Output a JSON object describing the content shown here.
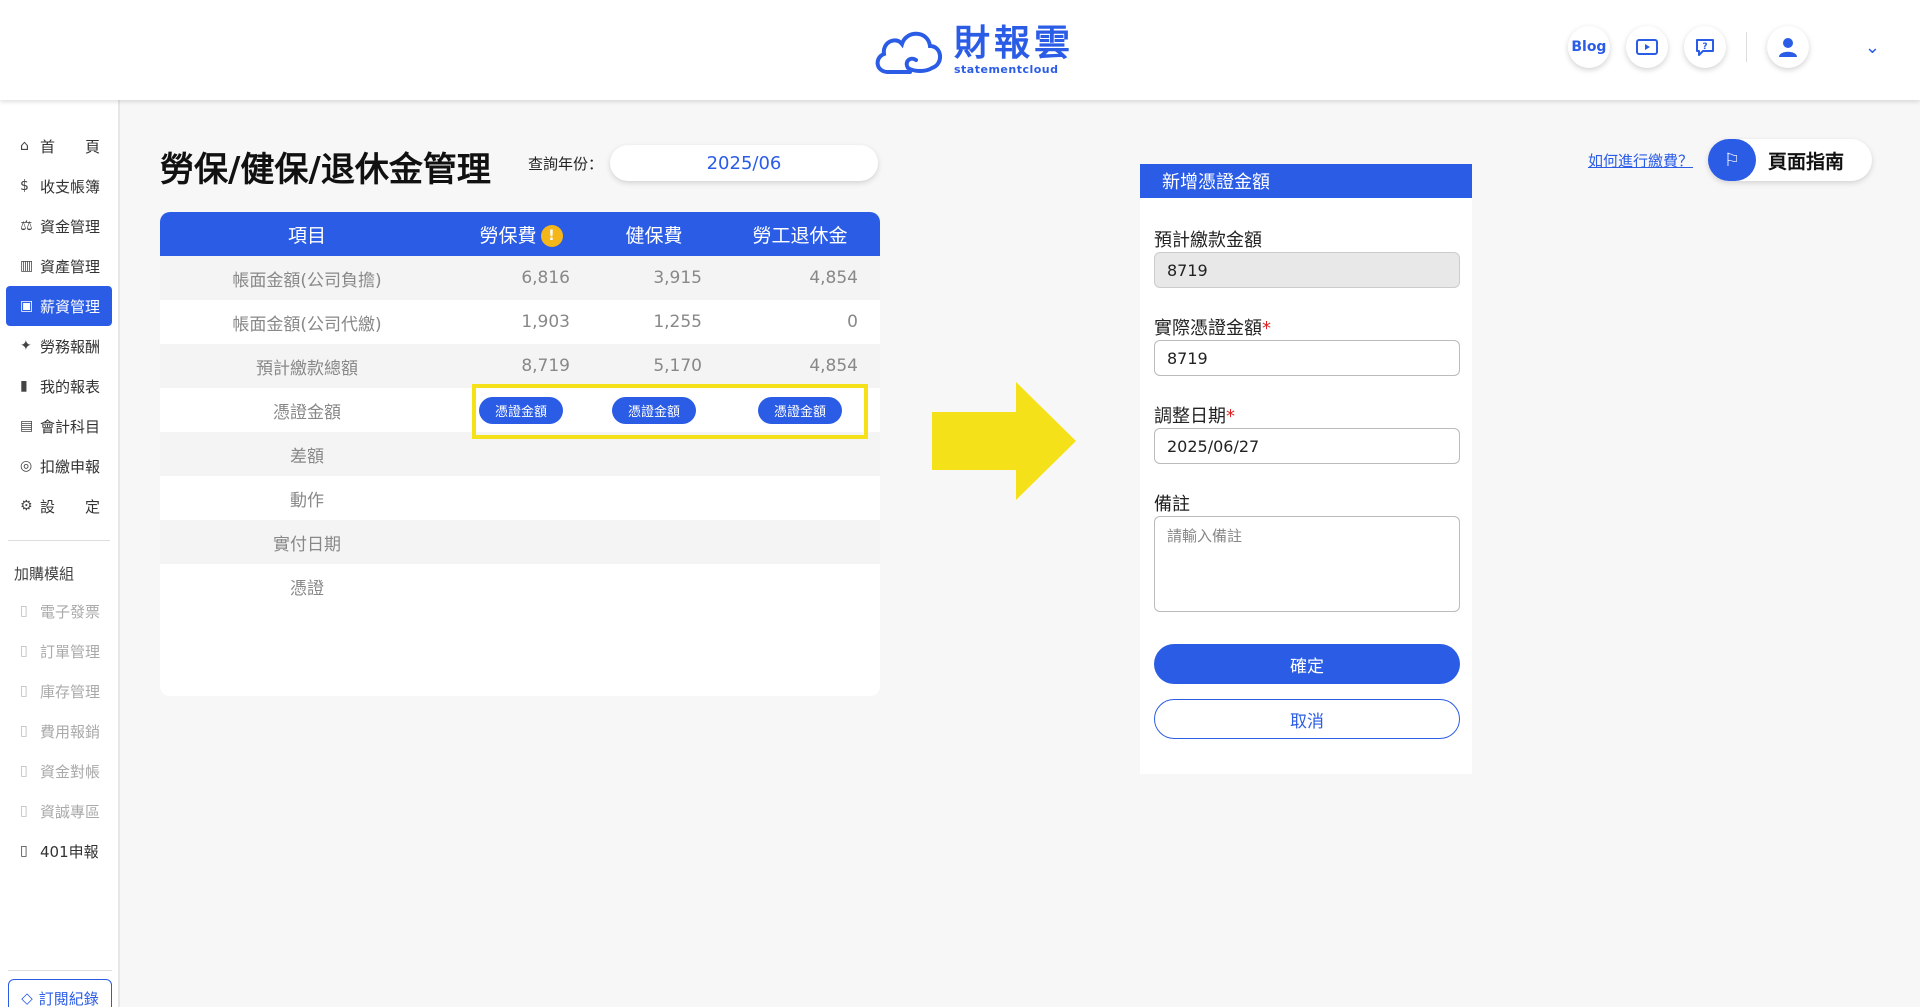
{
  "header": {
    "logo_cn": "財報雲",
    "logo_en": "statementcloud",
    "blog_label": "Blog"
  },
  "sidebar": {
    "items": [
      {
        "icon": "home-icon",
        "glyph": "⌂",
        "label": "首　　頁"
      },
      {
        "icon": "ledger-icon",
        "glyph": "$",
        "label": "收支帳簿"
      },
      {
        "icon": "funds-icon",
        "glyph": "⚖",
        "label": "資金管理"
      },
      {
        "icon": "assets-icon",
        "glyph": "▥",
        "label": "資產管理"
      },
      {
        "icon": "payroll-icon",
        "glyph": "▣",
        "label": "薪資管理"
      },
      {
        "icon": "labor-icon",
        "glyph": "✦",
        "label": "勞務報酬"
      },
      {
        "icon": "report-icon",
        "glyph": "▮",
        "label": "我的報表"
      },
      {
        "icon": "accounts-icon",
        "glyph": "▤",
        "label": "會計科目"
      },
      {
        "icon": "tax-icon",
        "glyph": "◎",
        "label": "扣繳申報"
      },
      {
        "icon": "settings-icon",
        "glyph": "⚙",
        "label": "設　　定"
      }
    ],
    "addon_header": "加購模組",
    "addons": [
      {
        "label": "電子發票"
      },
      {
        "label": "訂單管理"
      },
      {
        "label": "庫存管理"
      },
      {
        "label": "費用報銷"
      },
      {
        "label": "資金對帳"
      },
      {
        "label": "資誠專區"
      },
      {
        "label": "401申報"
      }
    ],
    "subscription_label": "訂閱紀錄"
  },
  "main": {
    "title": "勞保/健保/退休金管理",
    "year_label": "查詢年份：",
    "year_value": "2025/06",
    "table": {
      "headers": [
        "項目",
        "勞保費",
        "健保費",
        "勞工退休金"
      ],
      "rows": [
        {
          "label": "帳面金額(公司負擔)",
          "values": [
            "6,816",
            "3,915",
            "4,854"
          ]
        },
        {
          "label": "帳面金額(公司代繳)",
          "values": [
            "1,903",
            "1,255",
            "0"
          ]
        },
        {
          "label": "預計繳款總額",
          "values": [
            "8,719",
            "5,170",
            "4,854"
          ]
        },
        {
          "label": "憑證金額",
          "buttons": [
            "憑證金額",
            "憑證金額",
            "憑證金額"
          ]
        },
        {
          "label": "差額",
          "values": [
            "",
            "",
            ""
          ]
        },
        {
          "label": "動作",
          "values": [
            "",
            "",
            ""
          ]
        },
        {
          "label": "實付日期",
          "values": [
            "",
            "",
            ""
          ]
        },
        {
          "label": "憑證",
          "values": [
            "",
            "",
            ""
          ]
        }
      ]
    }
  },
  "guide": {
    "howto_link": "如何進行繳費？",
    "guide_label": "頁面指南"
  },
  "form": {
    "title": "新增憑證金額",
    "expected_label": "預計繳款金額",
    "expected_value": "8719",
    "actual_label": "實際憑證金額",
    "actual_value": "8719",
    "date_label": "調整日期",
    "date_value": "2025/06/27",
    "note_label": "備註",
    "note_placeholder": "請輸入備註",
    "required_mark": "*",
    "confirm_label": "確定",
    "cancel_label": "取消"
  },
  "colors": {
    "accent": "#2b5ce6",
    "highlight": "#f5e11a",
    "warning": "#f4b619"
  }
}
